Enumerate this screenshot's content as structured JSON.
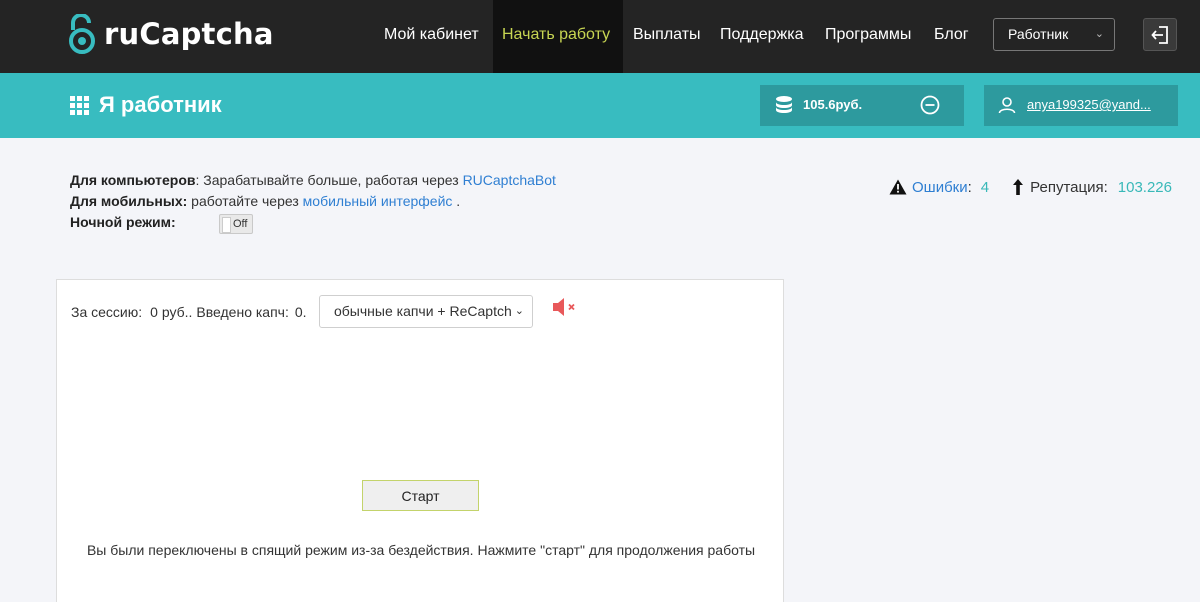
{
  "header": {
    "logo_text": "ruCaptcha",
    "nav": [
      {
        "label": "Мой кабинет",
        "active": false
      },
      {
        "label": "Начать работу",
        "active": true
      },
      {
        "label": "Выплаты",
        "active": false
      },
      {
        "label": "Поддержка",
        "active": false
      },
      {
        "label": "Программы",
        "active": false
      },
      {
        "label": "Блог",
        "active": false
      }
    ],
    "role_select_value": "Работник",
    "logout_icon": "logout-icon"
  },
  "subheader": {
    "title": "Я работник",
    "balance": "105.6руб.",
    "account_email": "anya199325@yand..."
  },
  "info": {
    "computers_label": "Для компьютеров",
    "computers_text": ": Зарабатывайте больше, работая через ",
    "computers_link": "RUCaptchaBot",
    "mobile_label": "Для мобильных:",
    "mobile_text": " работайте через ",
    "mobile_link": "мобильный интерфейс",
    "mobile_tail": " .",
    "night_label": "Ночной режим:",
    "night_toggle": "Off"
  },
  "stats": {
    "errors_label": "Ошибки",
    "errors_colon": ":",
    "errors_value": "4",
    "reputation_label": "Репутация:",
    "reputation_value": "103.226"
  },
  "work": {
    "session_label": "За сессию:",
    "session_value": "0 руб..",
    "entered_label": "Введено капч:",
    "entered_value": "0.",
    "captcha_type": "обычные капчи + ReCaptcha",
    "start_label": "Старт",
    "sleep_message": "Вы были переключены в спящий режим из-за бездействия. Нажмите \"старт\" для продолжения работы"
  },
  "colors": {
    "nav_bg": "#242424",
    "active_nav_text": "#c7d552",
    "teal": "#38bcc0",
    "teal_dark": "#2d9a9e",
    "link": "#2f7fd2",
    "mute_icon": "#e8585a"
  }
}
